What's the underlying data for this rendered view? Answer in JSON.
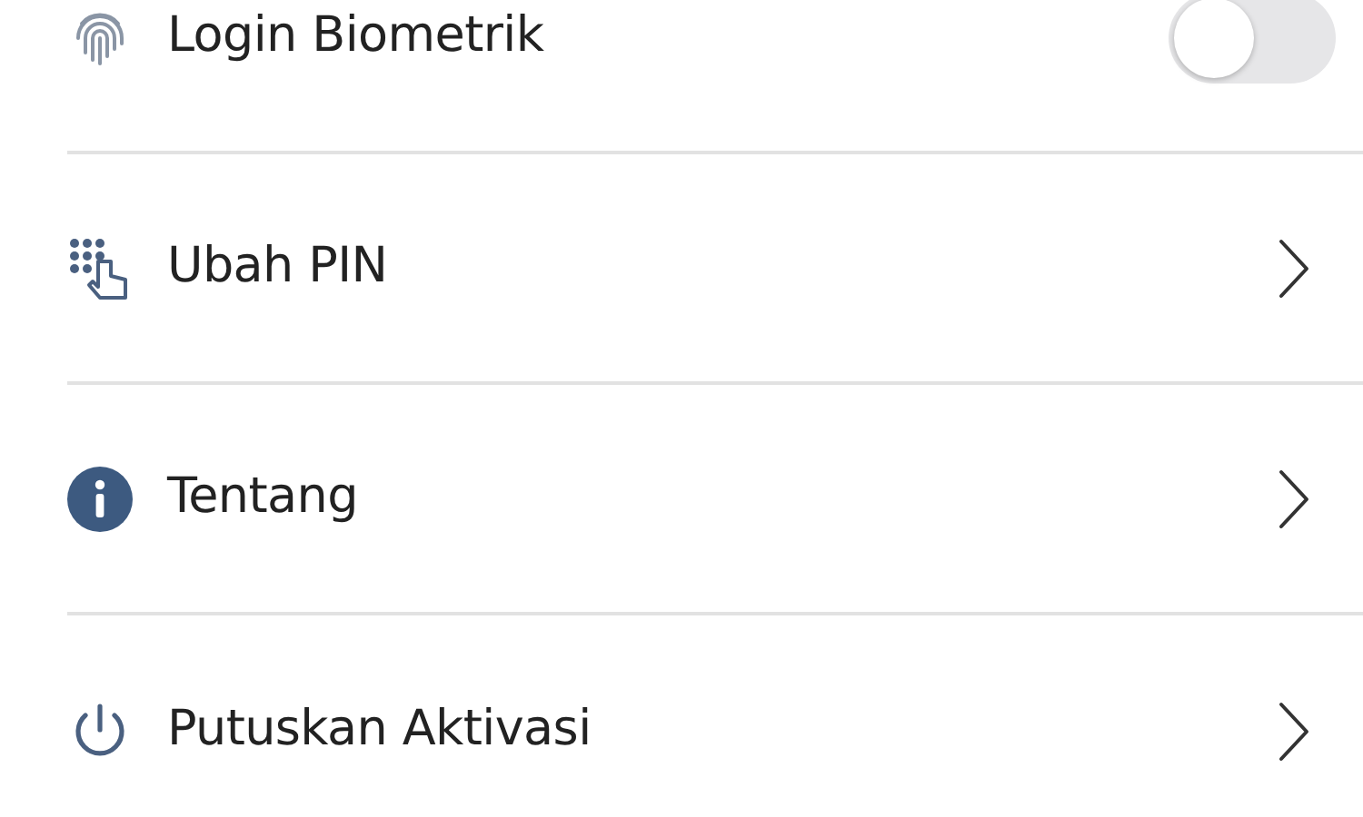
{
  "settings": [
    {
      "kind": "toggle",
      "label": "Login Biometrik",
      "on": false
    },
    {
      "kind": "link",
      "label": "Ubah PIN"
    },
    {
      "kind": "link",
      "label": "Tentang"
    },
    {
      "kind": "link",
      "label": "Putuskan Aktivasi"
    }
  ]
}
